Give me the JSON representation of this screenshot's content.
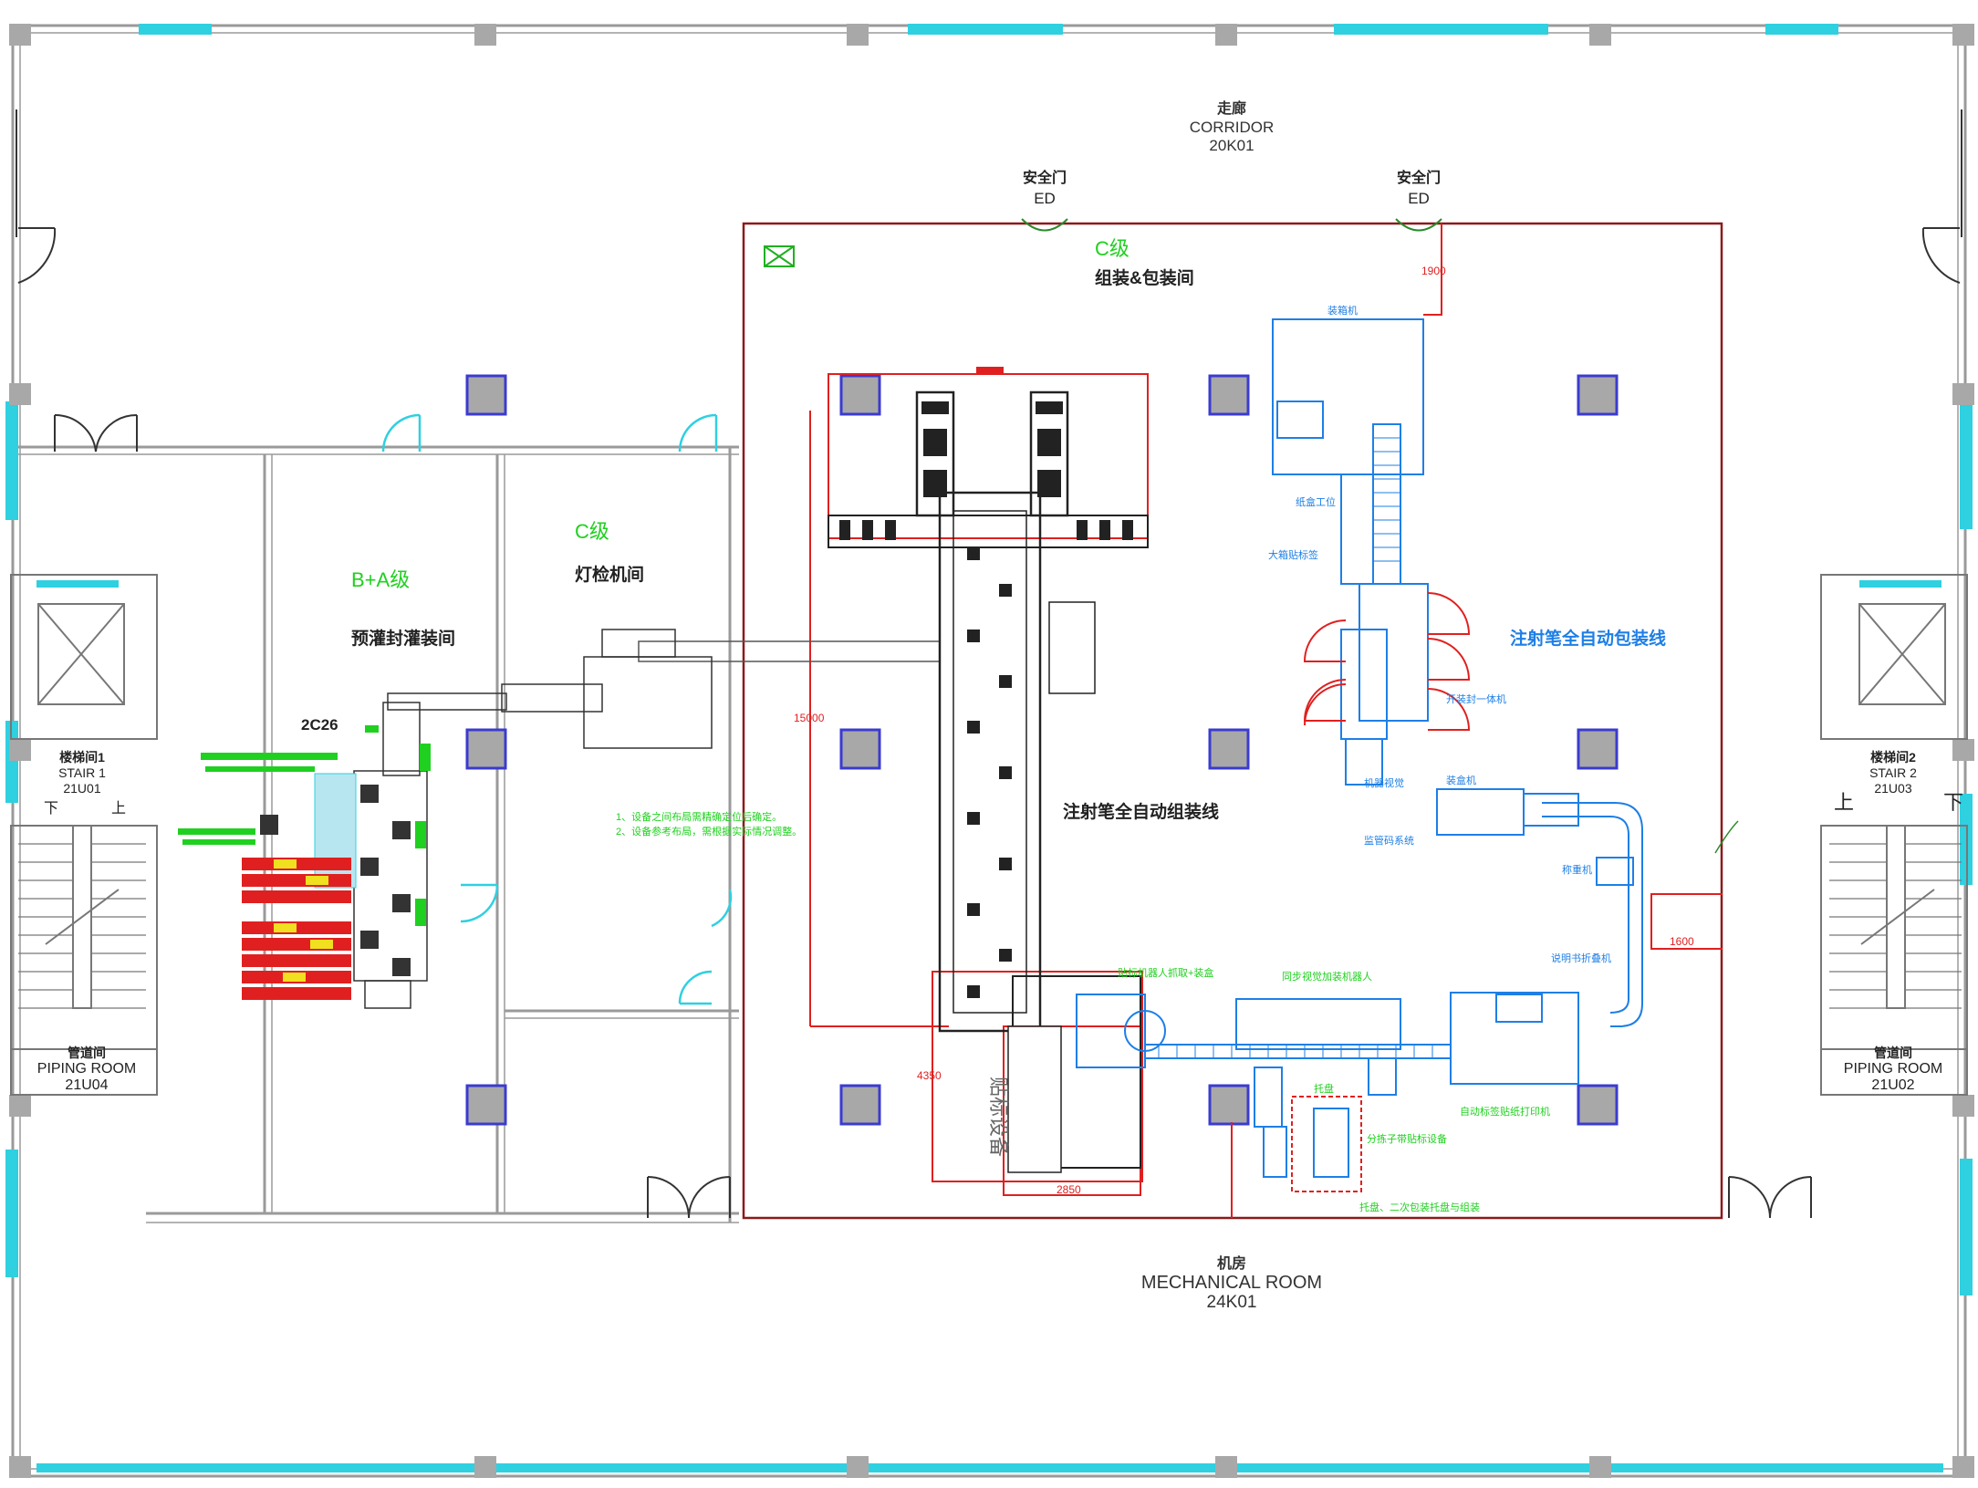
{
  "colors": {
    "wall": "#9a9a9a",
    "window": "#2fd0e0",
    "column": "#a8a8a8",
    "column_blue": "#3b3bd0",
    "red": "#e02020",
    "green": "#20d020",
    "blue": "#1e7fe6",
    "dark": "#222222",
    "yellow": "#f0e020"
  },
  "corridor": {
    "cn": "走廊",
    "en": "CORRIDOR",
    "code": "20K01"
  },
  "mechanical": {
    "cn": "机房",
    "en": "MECHANICAL ROOM",
    "code": "24K01"
  },
  "doors": {
    "ed_left_cn": "安全门",
    "ed_left_en": "ED",
    "ed_right_cn": "安全门",
    "ed_right_en": "ED"
  },
  "stair1": {
    "cn": "楼梯间1",
    "en": "STAIR 1",
    "code": "21U01",
    "down": "下",
    "up": "上"
  },
  "stair2": {
    "cn": "楼梯间2",
    "en": "STAIR 2",
    "code": "21U03",
    "down": "下",
    "up": "上"
  },
  "piping1": {
    "cn": "管道间",
    "en": "PIPING ROOM",
    "code": "21U04"
  },
  "piping2": {
    "cn": "管道间",
    "en": "PIPING ROOM",
    "code": "21U02"
  },
  "rooms": {
    "ba_grade": "B+A级",
    "ba_name": "预灌封灌装间",
    "c_left_grade": "C级",
    "c_left_name": "灯检机间",
    "c_main_grade": "C级",
    "c_main_name": "组装&包装间"
  },
  "equipment": {
    "tag_2c26": "2C26",
    "assembly_line": "注射笔全自动组装线",
    "packaging_line": "注射笔全自动包装线",
    "label_device": "贴标设备",
    "note_1": "1、设备之间布局需精确定位后确定。",
    "note_2": "2、设备参考布局，需根据实际情况调整。"
  },
  "blue_labels": [
    "装箱机",
    "纸盒工位",
    "大箱贴标签",
    "开装封一体机",
    "机器视觉",
    "装盒机",
    "监管码系统",
    "称重机",
    "说明书折叠机"
  ],
  "green_labels": [
    "贴标机器人抓取+装盒",
    "同步视觉加装机器人",
    "自动标签贴纸打印机",
    "分拣子带贴标设备",
    "托盘",
    "托盘、二次包装托盘与组装"
  ],
  "dimensions": {
    "d1900": "1900",
    "d15000": "15000",
    "d4350": "4350",
    "d2850": "2850",
    "d1600": "1600"
  }
}
